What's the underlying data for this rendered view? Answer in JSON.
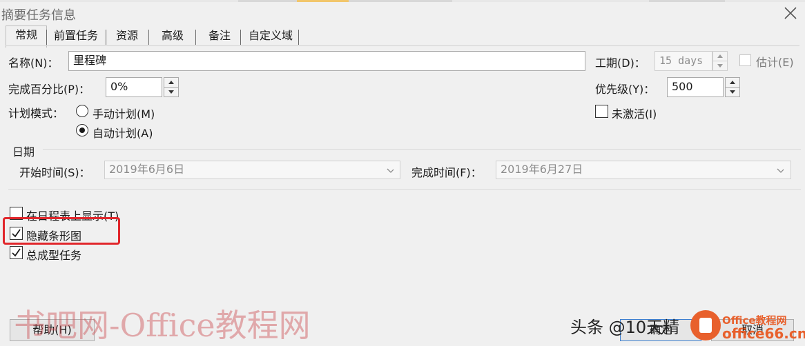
{
  "window": {
    "title": "摘要任务信息"
  },
  "tabs": [
    "常规",
    "前置任务",
    "资源",
    "高级",
    "备注",
    "自定义域"
  ],
  "name": {
    "label": "名称(N)：",
    "value": "里程碑"
  },
  "duration": {
    "label": "工期(D)：",
    "value": "15 days",
    "estimate_label": "估计(E)"
  },
  "percent": {
    "label": "完成百分比(P)：",
    "value": "0%"
  },
  "priority": {
    "label": "优先级(Y)：",
    "value": "500"
  },
  "schedule_mode": {
    "label": "计划模式：",
    "manual": "手动计划(M)",
    "auto": "自动计划(A)",
    "selected": "auto"
  },
  "inactive": {
    "label": "未激活(I)"
  },
  "dates": {
    "section": "日期",
    "start_label": "开始时间(S)：",
    "start_value": "2019年6月6日",
    "finish_label": "完成时间(F)：",
    "finish_value": "2019年6月27日"
  },
  "options": {
    "timeline": {
      "label": "在日程表上显示(T)",
      "checked": false
    },
    "hide_bar": {
      "label": "隐藏条形图",
      "checked": true
    },
    "summary": {
      "label": "总成型任务",
      "checked": true
    }
  },
  "buttons": {
    "help": "帮助(H)",
    "ok": "确定",
    "cancel": "取消"
  },
  "watermarks": {
    "site_cn": "书吧网-Office教程网",
    "author": "头条 @10天精",
    "brand_top": "Office教程网",
    "brand_bottom": "office66.cn"
  },
  "colors": {
    "highlight": "#e1262b",
    "brand": "#e8602c"
  }
}
